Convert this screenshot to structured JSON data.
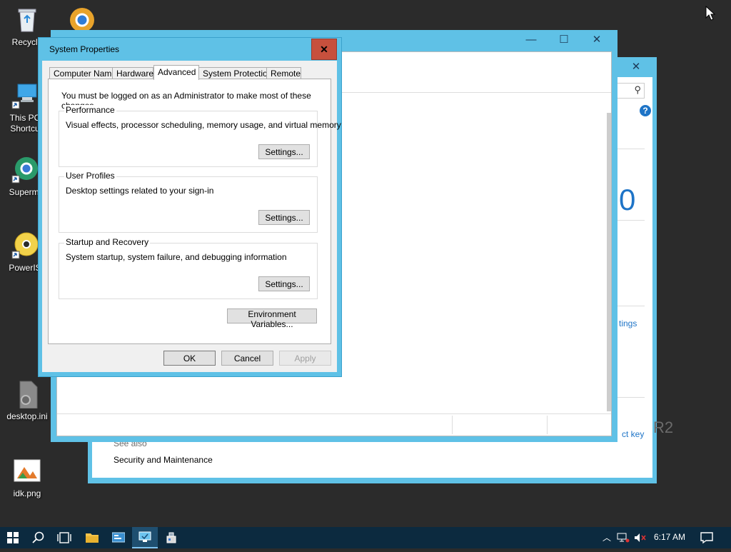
{
  "desktop": {
    "icons": [
      {
        "label": "Recycle",
        "icon": "recycle-bin-icon"
      },
      {
        "label": "This PC Shortcu",
        "line1": "This PC",
        "line2": "Shortcu",
        "icon": "computer-icon"
      },
      {
        "label": "Supermi",
        "icon": "chrome-icon"
      },
      {
        "label": "PowerIS",
        "icon": "disc-icon"
      },
      {
        "label": "desktop.ini",
        "icon": "settings-file-icon"
      },
      {
        "label": "idk.png",
        "icon": "image-file-icon"
      }
    ]
  },
  "background_window": {
    "partial_texts": {
      "zero": "0",
      "settings_link": "tings",
      "product_key": "ct key",
      "r2": "R2",
      "see_also": "See also",
      "security_maintenance": "Security and Maintenance"
    }
  },
  "dialog": {
    "title": "System Properties",
    "tabs": [
      "Computer Name",
      "Hardware",
      "Advanced",
      "System Protection",
      "Remote"
    ],
    "active_tab": "Advanced",
    "admin_note": "You must be logged on as an Administrator to make most of these changes.",
    "groups": [
      {
        "title": "Performance",
        "desc": "Visual effects, processor scheduling, memory usage, and virtual memory",
        "button": "Settings..."
      },
      {
        "title": "User Profiles",
        "desc": "Desktop settings related to your sign-in",
        "button": "Settings..."
      },
      {
        "title": "Startup and Recovery",
        "desc": "System startup, system failure, and debugging information",
        "button": "Settings..."
      }
    ],
    "env_button": "Environment Variables...",
    "ok": "OK",
    "cancel": "Cancel",
    "apply": "Apply"
  },
  "taskbar": {
    "clock": "6:17 AM",
    "items": [
      "windows-start-icon",
      "search-icon",
      "task-view-icon",
      "file-explorer-icon",
      "server-manager-icon",
      "system-icon",
      "network-tool-icon"
    ]
  },
  "colors": {
    "window_frame": "#5fc1e6",
    "close_red": "#c7503d",
    "taskbar": "#0c2a3f",
    "desktop": "#2b2b2b",
    "link_blue": "#1e74c7"
  }
}
